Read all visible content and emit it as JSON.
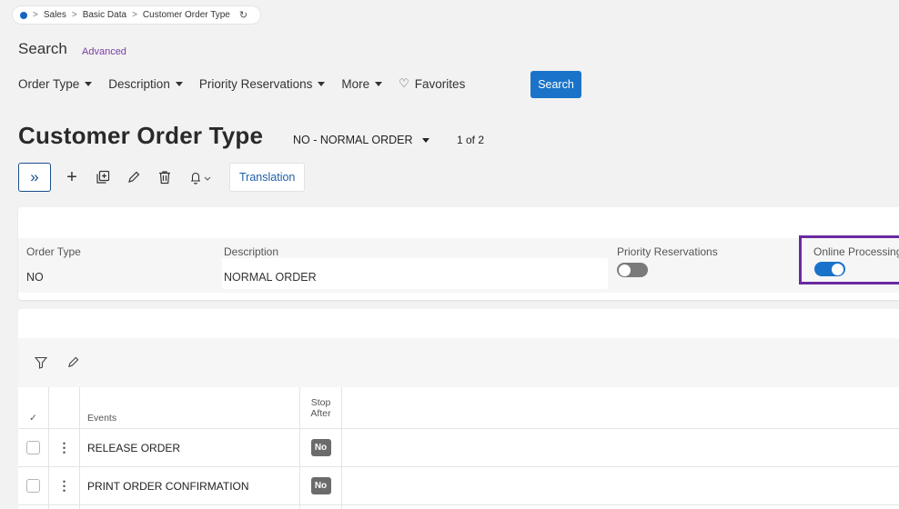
{
  "breadcrumb": {
    "items": [
      "Sales",
      "Basic Data",
      "Customer Order Type"
    ],
    "separator": ">",
    "refresh_icon": "refresh-icon"
  },
  "search": {
    "title": "Search",
    "advanced_link": "Advanced",
    "filters": [
      "Order Type",
      "Description",
      "Priority Reservations",
      "More"
    ],
    "favorites": "Favorites",
    "search_button": "Search"
  },
  "page": {
    "title": "Customer Order Type",
    "record": "NO - NORMAL ORDER",
    "record_count": "1 of 2"
  },
  "toolbar": {
    "expand_icon": "»",
    "translation": "Translation"
  },
  "header_form": {
    "order_type_label": "Order Type",
    "order_type_value": "NO",
    "description_label": "Description",
    "description_value": "NORMAL ORDER",
    "priority_label": "Priority Reservations",
    "priority_on": false,
    "online_label": "Online Processing",
    "online_on": true
  },
  "events_grid": {
    "columns": {
      "events": "Events",
      "stop_after_line1": "Stop",
      "stop_after_line2": "After"
    },
    "rows": [
      {
        "event": "RELEASE ORDER",
        "stop_after": "No"
      },
      {
        "event": "PRINT ORDER CONFIRMATION",
        "stop_after": "No"
      }
    ]
  },
  "colors": {
    "accent": "#1a73c8",
    "highlight": "#6a2aa0",
    "advanced_link": "#7b3fa0"
  }
}
